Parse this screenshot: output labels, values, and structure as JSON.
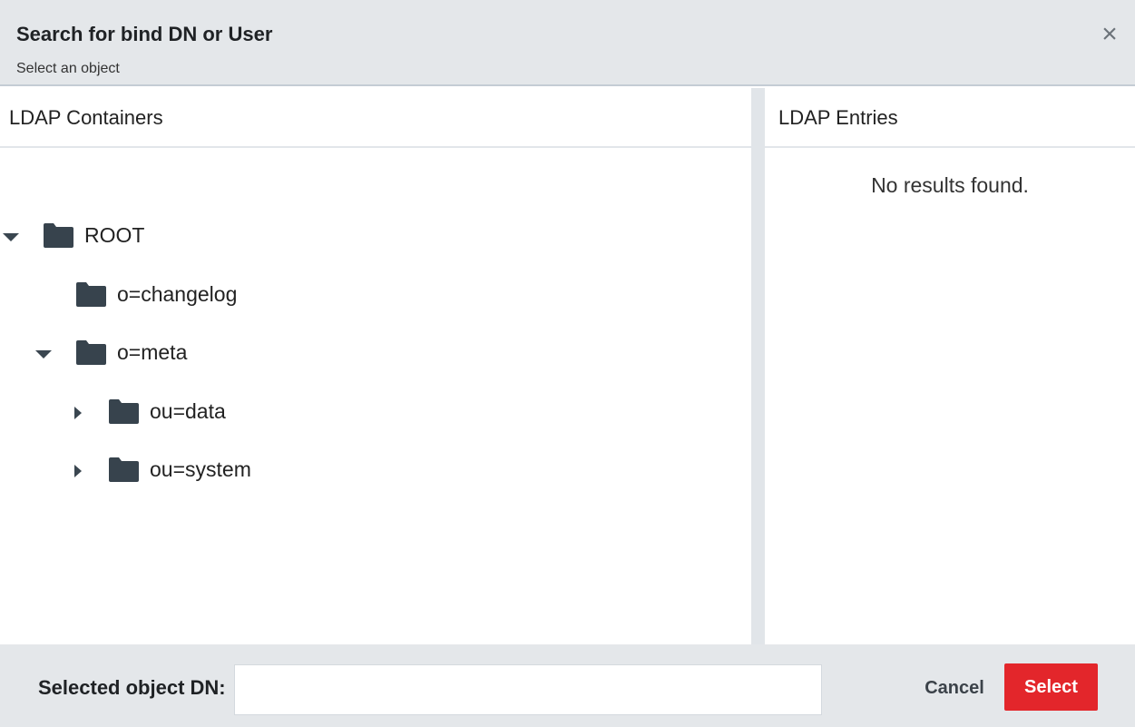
{
  "dialog": {
    "title": "Search for bind DN or User",
    "subtitle": "Select an object",
    "close_icon": "×"
  },
  "containers": {
    "title": "LDAP Containers",
    "tree": [
      {
        "label": "ROOT",
        "expanded": true,
        "level": 0
      },
      {
        "label": "o=changelog",
        "expanded": null,
        "level": 1
      },
      {
        "label": "o=meta",
        "expanded": true,
        "level": 1
      },
      {
        "label": "ou=data",
        "expanded": false,
        "level": 2
      },
      {
        "label": "ou=system",
        "expanded": false,
        "level": 2
      }
    ]
  },
  "entries": {
    "title": "LDAP Entries",
    "empty_message": "No results found."
  },
  "footer": {
    "dn_label": "Selected object DN:",
    "dn_value": "",
    "cancel_label": "Cancel",
    "select_label": "Select"
  },
  "colors": {
    "accent": "#e3262b",
    "folder": "#37434d",
    "header_bg": "#e4e7ea"
  }
}
